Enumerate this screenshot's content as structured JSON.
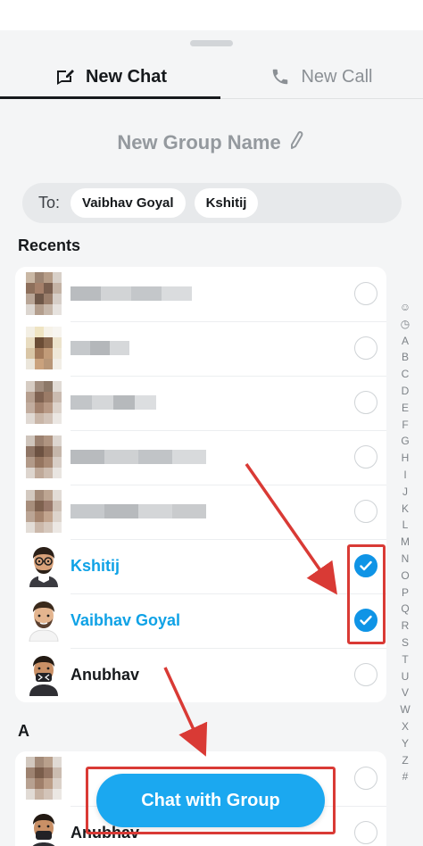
{
  "tabs": {
    "new_chat": "New Chat",
    "new_call": "New Call"
  },
  "group_name_placeholder": "New Group Name",
  "to_bar": {
    "label": "To:",
    "chips": [
      "Vaibhav Goyal",
      "Kshitij"
    ]
  },
  "sections": {
    "recents": "Recents",
    "a": "A"
  },
  "recents": [
    {
      "name": "",
      "blurred": true,
      "selected": false
    },
    {
      "name": "",
      "blurred": true,
      "selected": false
    },
    {
      "name": "",
      "blurred": true,
      "selected": false
    },
    {
      "name": "",
      "blurred": true,
      "selected": false
    },
    {
      "name": "",
      "blurred": true,
      "selected": false
    },
    {
      "name": "Kshitij",
      "blurred": false,
      "selected": true
    },
    {
      "name": "Vaibhav Goyal",
      "blurred": false,
      "selected": true
    },
    {
      "name": "Anubhav",
      "blurred": false,
      "selected": false
    }
  ],
  "a_list": [
    {
      "name": "",
      "blurred": true,
      "selected": false
    },
    {
      "name": "Anubhav",
      "blurred": false,
      "selected": false
    }
  ],
  "alphabet": [
    "☺",
    "◷",
    "A",
    "B",
    "C",
    "D",
    "E",
    "F",
    "G",
    "H",
    "I",
    "J",
    "K",
    "L",
    "M",
    "N",
    "O",
    "P",
    "Q",
    "R",
    "S",
    "T",
    "U",
    "V",
    "W",
    "X",
    "Y",
    "Z",
    "#"
  ],
  "cta_label": "Chat with Group",
  "colors": {
    "accent": "#0f94e6",
    "selected_text": "#0fa2e6",
    "annotation": "#d93a35"
  }
}
